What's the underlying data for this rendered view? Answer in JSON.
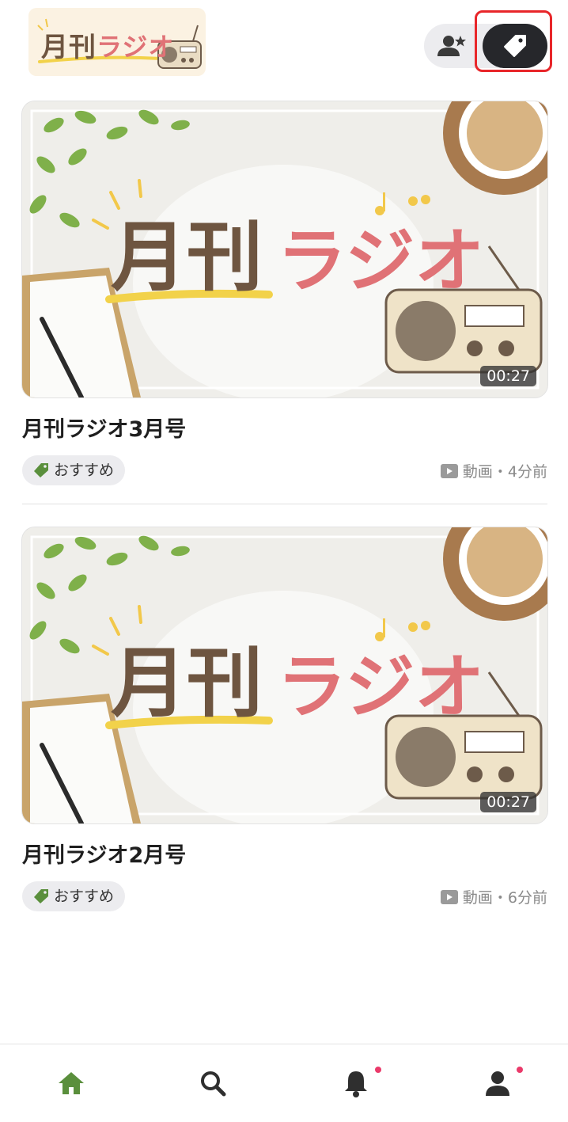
{
  "header": {
    "logo": {
      "text_a": "月刊",
      "text_b": "ラジオ"
    },
    "toggle": {
      "left_icon": "people-star-icon",
      "right_icon": "tag-icon",
      "active": "right"
    }
  },
  "posts": [
    {
      "thumbnail": {
        "title_a": "月刊",
        "title_b": "ラジオ"
      },
      "duration": "00:27",
      "title": "月刊ラジオ3月号",
      "tag": "おすすめ",
      "info": "動画・4分前"
    },
    {
      "thumbnail": {
        "title_a": "月刊",
        "title_b": "ラジオ"
      },
      "duration": "00:27",
      "title": "月刊ラジオ2月号",
      "tag": "おすすめ",
      "info": "動画・6分前"
    }
  ],
  "bottom_nav": {
    "items": [
      "home-icon",
      "search-icon",
      "bell-icon",
      "profile-icon"
    ],
    "active": "home-icon"
  },
  "colors": {
    "accent_green": "#5a8f3c",
    "badge_pink": "#ea3a6a",
    "dark_toggle": "#26272b",
    "highlight_red": "#e8262a"
  }
}
